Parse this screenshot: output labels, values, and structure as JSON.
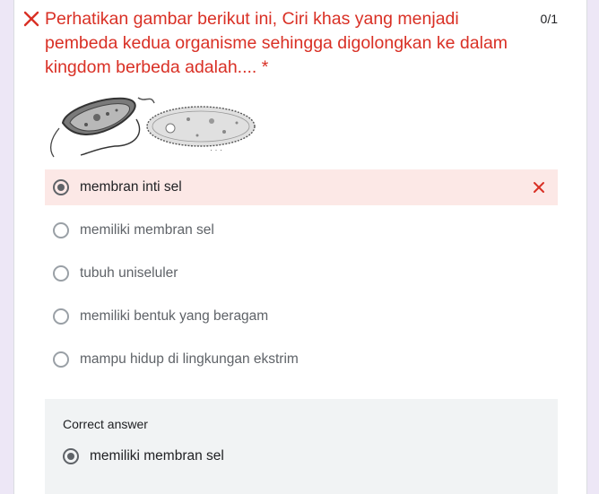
{
  "question": {
    "title": "Perhatikan gambar berikut ini, Ciri khas yang menjadi pembeda kedua organisme sehingga digolongkan ke dalam kingdom berbeda adalah.... *",
    "score": "0/1",
    "status_icon": "wrong-x-icon",
    "status_color": "#d93025"
  },
  "figure": {
    "left_organism": "bacterium-illustration",
    "right_organism": "paramecium-illustration"
  },
  "options": [
    {
      "label": "membran inti sel",
      "selected": true,
      "result": "incorrect"
    },
    {
      "label": "memiliki membran sel",
      "selected": false
    },
    {
      "label": "tubuh uniseluler",
      "selected": false
    },
    {
      "label": "memiliki bentuk yang beragam",
      "selected": false
    },
    {
      "label": "mampu hidup di lingkungan ekstrim",
      "selected": false
    }
  ],
  "correct_answer": {
    "heading": "Correct answer",
    "label": "memiliki membran sel"
  },
  "colors": {
    "background": "#ede7f6",
    "incorrect_highlight": "#fce8e6",
    "correct_box": "#f1f3f4"
  }
}
